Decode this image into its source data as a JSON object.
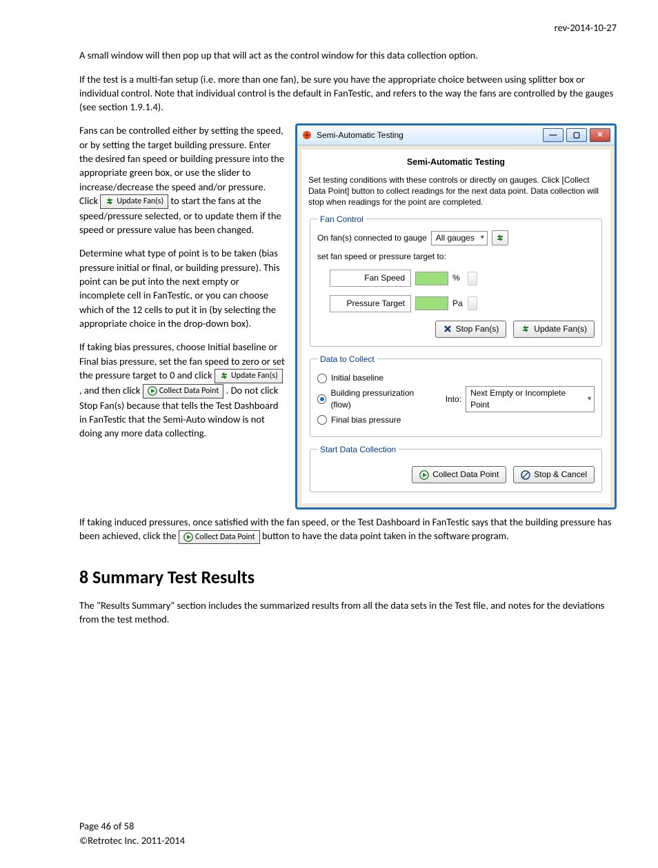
{
  "header": {
    "revision": "rev-2014-10-27"
  },
  "body": {
    "p1": "A small window will then pop up that will act as the control window for this data collection option.",
    "p2": "If the test is a multi-fan setup (i.e. more than one fan), be sure you have the appropriate choice between using splitter box or individual control.  Note that individual control is the default in FanTestic, and refers to the way the fans are controlled by the gauges (see section 1.9.1.4).",
    "p3a": "Fans can be controlled either by setting the speed, or by setting the target building pressure.  Enter the desired fan speed or building pressure into the appropriate green box, or use the slider to increase/decrease the speed and/or pressure.  Click ",
    "p3b": " to start the fans at the speed/pressure selected, or to update them if the speed or pressure value has been changed.",
    "p4": "Determine what type of point is to be taken (bias pressure initial or final, or building pressure).  This point can be put into the next empty or incomplete cell in FanTestic, or you can choose which of the 12 cells to put it in (by selecting the appropriate choice in the drop-down box).",
    "p5a": "If taking bias pressures, choose Initial baseline or Final bias pressure, set the fan speed to zero or set the pressure target to 0 and click ",
    "p5b": ", and then click ",
    "p5c": ".  Do not click Stop Fan(s) because that tells the Test Dashboard in FanTestic that the Semi-Auto window is not doing any more data collecting.",
    "p6a": "If taking induced pressures, once satisfied with the fan speed, or the Test Dashboard in FanTestic says that the building pressure has been achieved, click the ",
    "p6b": " button to have the data point taken in the software program."
  },
  "buttons": {
    "update_fans": "Update Fan(s)",
    "collect_data_point": "Collect Data Point"
  },
  "window": {
    "title": "Semi-Automatic Testing",
    "heading": "Semi-Automatic Testing",
    "desc": "Set testing conditions with these controls or directly on gauges.  Click [Collect Data Point] button to collect readings for the next data point.  Data collection will stop when readings for the point are completed.",
    "fan_control": {
      "legend": "Fan Control",
      "on_fans": "On fan(s) connected to gauge",
      "gauge_sel": "All gauges",
      "set_speed": "set fan speed or pressure target to:",
      "fan_speed_label": "Fan Speed",
      "fan_speed_unit": "%",
      "pressure_label": "Pressure Target",
      "pressure_unit": "Pa",
      "stop_fans": "Stop Fan(s)",
      "update_fans": "Update Fan(s)"
    },
    "data_to_collect": {
      "legend": "Data to Collect",
      "opt1": "Initial baseline",
      "opt2": "Building pressurization (flow)",
      "opt3": "Final bias pressure",
      "into_label": "Into:",
      "into_sel": "Next Empty or Incomplete Point"
    },
    "start_collection": {
      "legend": "Start Data Collection",
      "collect": "Collect Data Point",
      "stop_cancel": "Stop & Cancel"
    }
  },
  "section8": {
    "heading": "8   Summary Test Results",
    "p": "The \"Results Summary\" section includes the summarized results from all the data sets in the Test file, and notes for the deviations from the test method."
  },
  "footer": {
    "page": "Page 46 of 58",
    "copy": "©Retrotec Inc. 2011-2014"
  }
}
